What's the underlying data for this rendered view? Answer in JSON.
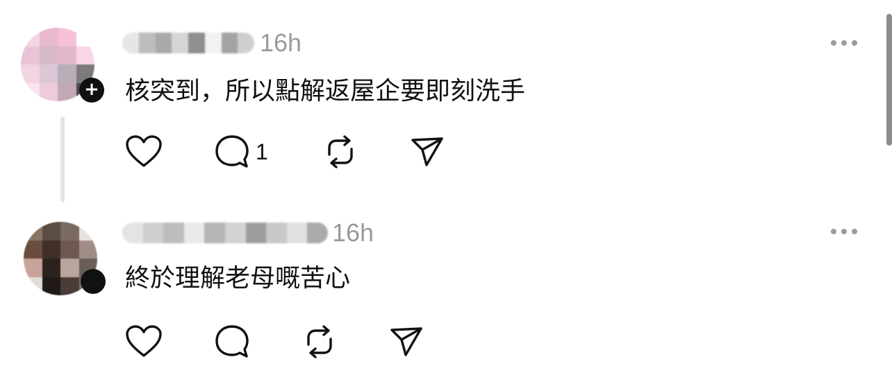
{
  "posts": [
    {
      "timestamp": "16h",
      "text": "核突到，所以點解返屋企要即刻洗手",
      "reply_count": "1",
      "avatar_colors": [
        "#f3d6e4",
        "#e8b8cf",
        "#f6c0d6",
        "#ffffff",
        "#e9c4d6",
        "#d7b9ca",
        "#e0b6cb",
        "#f7d7e5",
        "#f2d3e1",
        "#dcc7d6",
        "#b9aeb7",
        "#7d7a7c",
        "#fbe4ee",
        "#eecadb",
        "#c2a9b8",
        "#4a4a4a"
      ],
      "username_blur": [
        "#e6e6e6",
        "#bdbdbd",
        "#a9a9a9",
        "#d6d6d6",
        "#8f8f8f",
        "#f2f2f2",
        "#a3a3a3",
        "#cfcfcf"
      ],
      "actions": [
        "heart-icon",
        "comment-icon",
        "repost-icon",
        "share-icon"
      ]
    },
    {
      "timestamp": "16h",
      "text": "終於理解老母嘅苦心",
      "reply_count": "",
      "avatar_colors": [
        "#8a7462",
        "#5b4d44",
        "#7a6a60",
        "#e8e3e1",
        "#6a4d3c",
        "#3f3029",
        "#6e5850",
        "#a08e86",
        "#c7a39a",
        "#2b2220",
        "#b8a59b",
        "#6b5d57",
        "#e4dcd8",
        "#1f1a18",
        "#4a3d37",
        "#7d6c64"
      ],
      "username_blur": [
        "#e4e4e4",
        "#cfcfcf",
        "#bdbdbd",
        "#e9e9e9",
        "#b5b5b5",
        "#d2d2d2",
        "#9e9e9e",
        "#c8c8c8",
        "#e0e0e0",
        "#aaaaaa"
      ],
      "actions": [
        "heart-icon",
        "comment-icon",
        "repost-icon",
        "share-icon"
      ]
    }
  ],
  "colors": {
    "text": "#111111",
    "muted": "#9a9a9a",
    "thread_line": "#e3e3e3"
  }
}
